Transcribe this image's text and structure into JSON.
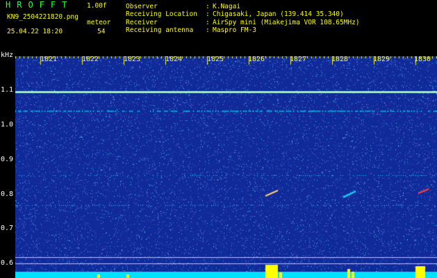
{
  "header": {
    "app_title": "HROFFT",
    "version": "1.00f",
    "filename": "KN9_2504221820.png",
    "meteor_label": "meteor",
    "datetime": "25.04.22 18:20",
    "meteor_count": "54"
  },
  "metadata": [
    {
      "label": "Observer",
      "value": "K.Nagai"
    },
    {
      "label": "Receiving Location",
      "value": "Chigasaki, Japan (139.414 35.340)"
    },
    {
      "label": "Receiver",
      "value": "AirSpy mini (Miakejima VOR 108.65MHz)"
    },
    {
      "label": "Receiving antenna",
      "value": "Maspro FM-3"
    }
  ],
  "spectrogram": {
    "y_unit": "kHz",
    "y_ticks": [
      "1.1",
      "1.0",
      "0.9",
      "0.8",
      "0.7",
      "0.6"
    ],
    "x_ticks": [
      "1821",
      "1822",
      "1823",
      "1824",
      "1825",
      "1826",
      "1827",
      "1828",
      "1829",
      "1830"
    ],
    "colors": {
      "background": "#112a9a",
      "carrier": "#4cff9c",
      "signal": "#00e0ff",
      "strong": "#ffff00",
      "meteor": "#ff4040"
    }
  }
}
